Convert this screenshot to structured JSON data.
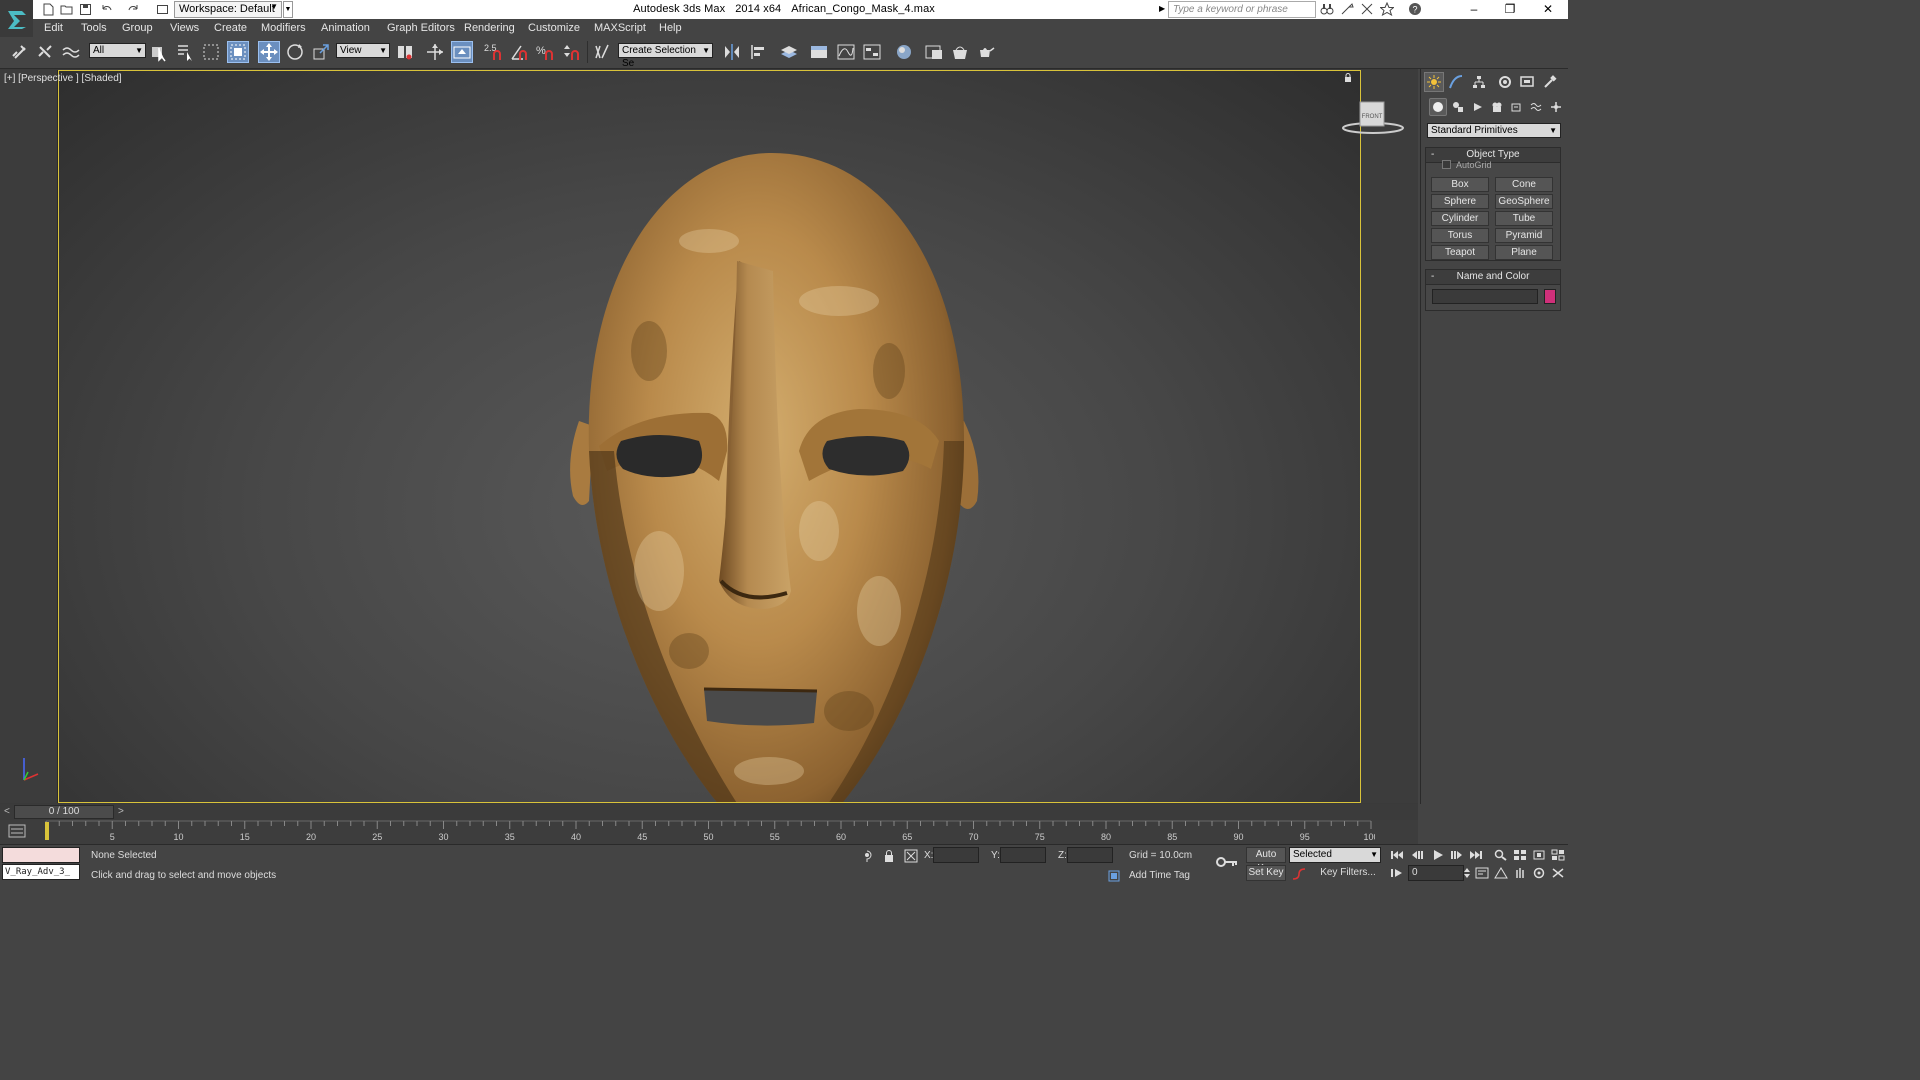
{
  "titlebar": {
    "workspace_label": "Workspace: Default",
    "app_name": "Autodesk 3ds Max",
    "version": "2014 x64",
    "file_name": "African_Congo_Mask_4.max",
    "search_placeholder": "Type a keyword or phrase",
    "minimize": "–",
    "restore": "❐",
    "close": "✕"
  },
  "menu": [
    "Edit",
    "Tools",
    "Group",
    "Views",
    "Create",
    "Modifiers",
    "Animation",
    "Graph Editors",
    "Rendering",
    "Customize",
    "MAXScript",
    "Help"
  ],
  "toolbar": {
    "selection_filter": "All",
    "ref_coord_system": "View",
    "snap_label": "2.5",
    "named_selection_set": "Create Selection Se"
  },
  "viewport": {
    "label": "[+] [Perspective ] [Shaded]",
    "viewcube_face": "FRONT"
  },
  "command_panel": {
    "category_dropdown": "Standard Primitives",
    "object_type_title": "Object Type",
    "autogrid_label": "AutoGrid",
    "primitives": [
      "Box",
      "Cone",
      "Sphere",
      "GeoSphere",
      "Cylinder",
      "Tube",
      "Torus",
      "Pyramid",
      "Teapot",
      "Plane"
    ],
    "name_color_title": "Name and Color",
    "object_color": "#d0307a"
  },
  "timeline": {
    "frame_display": "0 / 100",
    "ticks": [
      5,
      10,
      15,
      20,
      25,
      30,
      35,
      40,
      45,
      50,
      55,
      60,
      65,
      70,
      75,
      80,
      85,
      90,
      95,
      100
    ]
  },
  "status": {
    "listener_text": "V_Ray_Adv_3_",
    "selection": "None Selected",
    "prompt": "Click and drag to select and move objects",
    "x_label": "X:",
    "y_label": "Y:",
    "z_label": "Z:",
    "grid": "Grid = 10.0cm",
    "add_time_tag": "Add Time Tag",
    "auto_key": "Auto Key",
    "set_key": "Set Key",
    "key_mode": "Selected",
    "key_filters": "Key Filters...",
    "current_frame": "0"
  }
}
